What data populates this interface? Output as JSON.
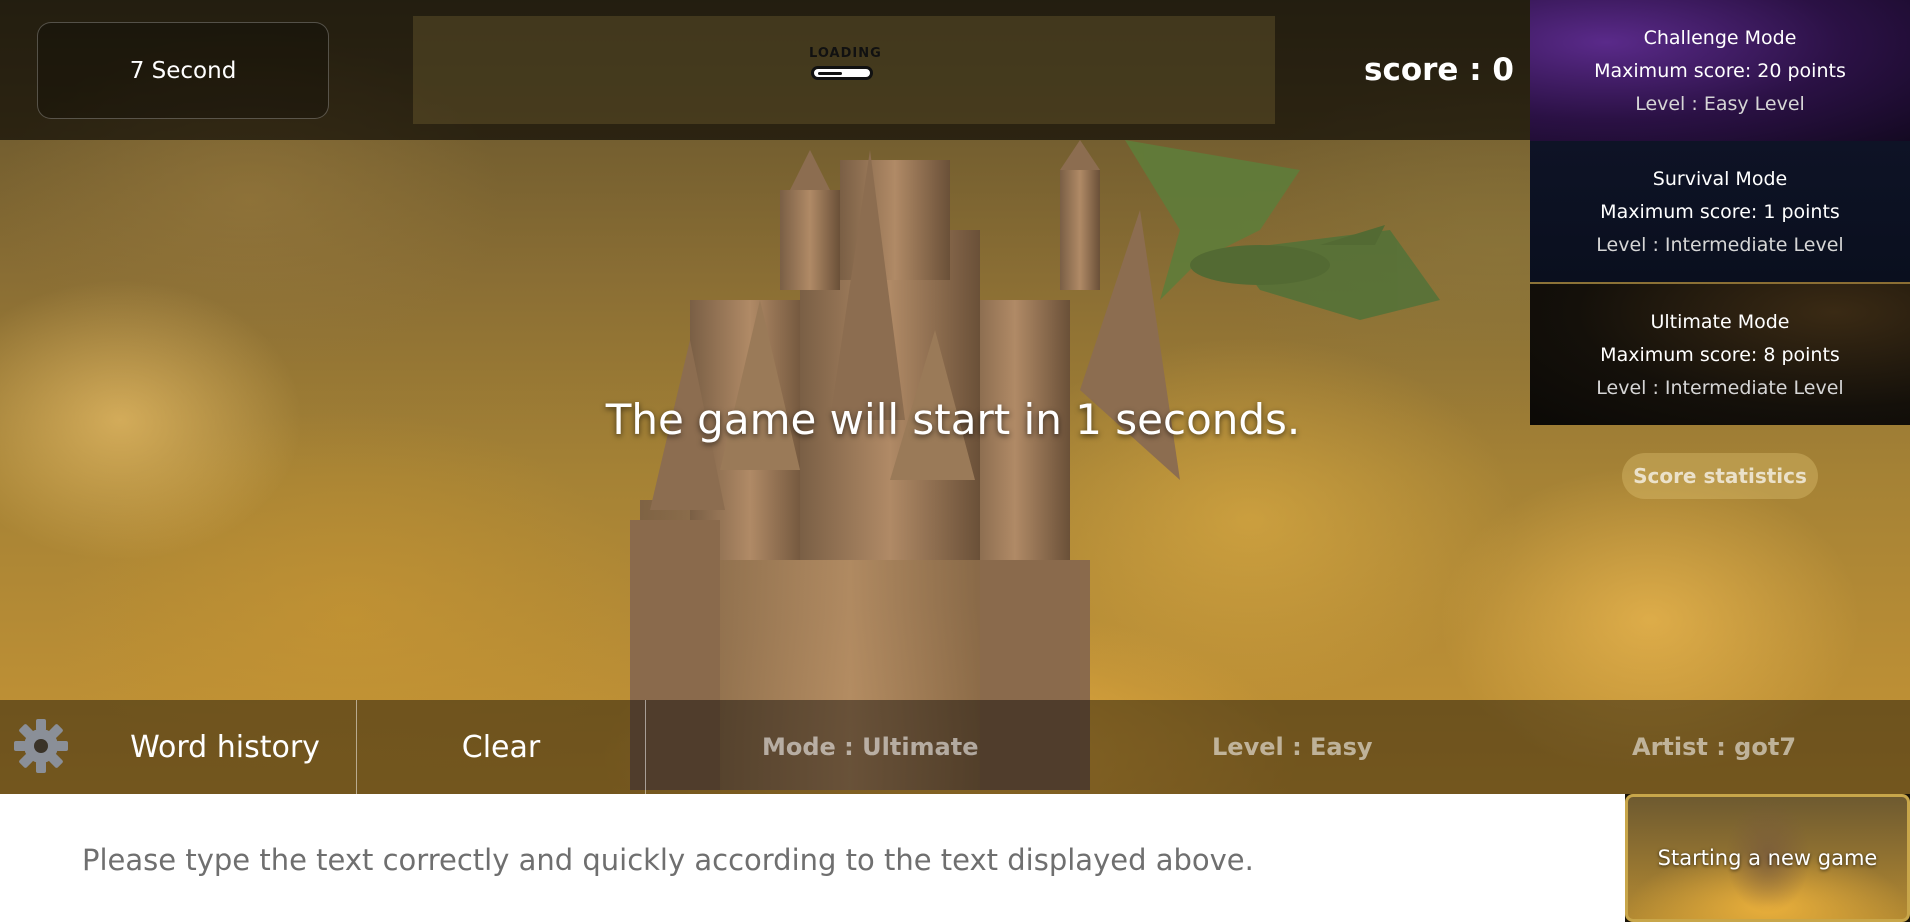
{
  "header": {
    "timer_text": "7 Second",
    "loading_label": "LOADING",
    "score_text": "score : 0"
  },
  "modes": [
    {
      "title": "Challenge Mode",
      "max_score": "Maximum score: 20 points",
      "level": "Level : Easy Level"
    },
    {
      "title": "Survival Mode",
      "max_score": "Maximum score: 1 points",
      "level": "Level : Intermediate Level"
    },
    {
      "title": "Ultimate Mode",
      "max_score": "Maximum score: 8 points",
      "level": "Level : Intermediate Level"
    }
  ],
  "score_statistics_label": "Score statistics",
  "countdown_text": "The game will start in 1 seconds.",
  "bottom_bar": {
    "settings_icon": "gear-icon",
    "word_history_label": "Word history",
    "clear_label": "Clear",
    "mode_text": "Mode : Ultimate",
    "level_text": "Level : Easy",
    "artist_text": "Artist : got7"
  },
  "input": {
    "placeholder": "Please type the text correctly and quickly according to the text displayed above."
  },
  "new_game_label": "Starting a new game",
  "colors": {
    "accent_gold": "#c8a64a",
    "challenge_card": "#2b1145",
    "survival_card": "#0e1326",
    "ultimate_card": "#14100a"
  }
}
